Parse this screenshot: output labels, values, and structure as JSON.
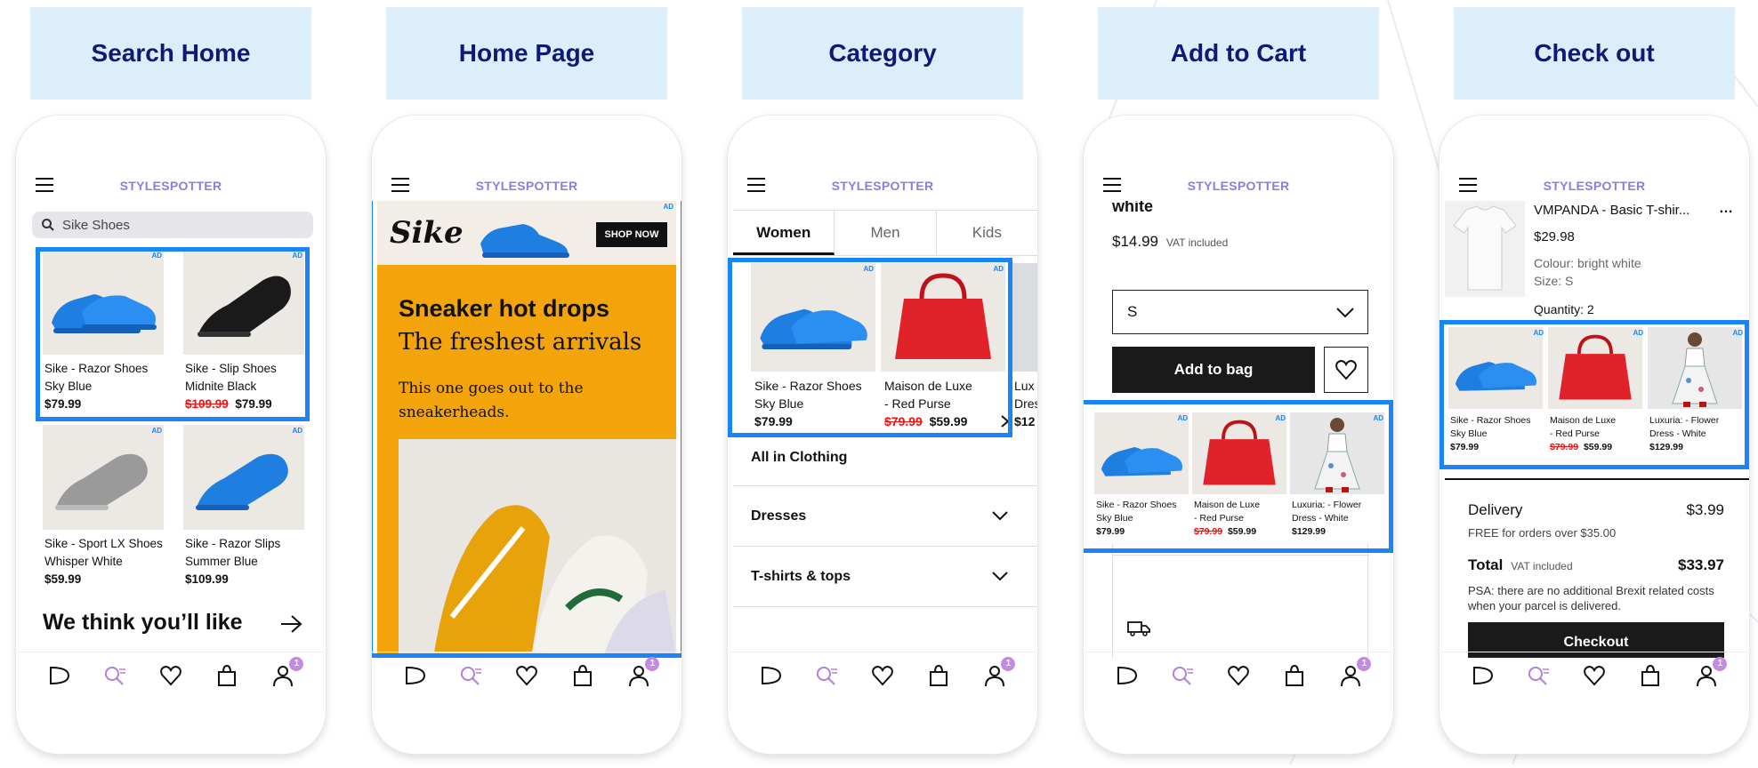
{
  "colors": {
    "accent": "#1a86f5",
    "brand": "#8a7de0",
    "label_bg": "#ddeefb",
    "strike": "#e11111"
  },
  "app": {
    "brand": "STYLESPOTTER",
    "nav_badge": "1",
    "ad_tag": "AD"
  },
  "steps": [
    {
      "label": "Search Home"
    },
    {
      "label": "Home Page"
    },
    {
      "label": "Category"
    },
    {
      "label": "Add to Cart"
    },
    {
      "label": "Check out"
    }
  ],
  "search": {
    "value": "Sike Shoes",
    "products": [
      {
        "name1": "Sike - Razor Shoes",
        "name2": "Sky Blue",
        "price": "$79.99",
        "old": ""
      },
      {
        "name1": "Sike - Slip Shoes",
        "name2": "Midnite Black",
        "price": "$79.99",
        "old": "$109.99"
      },
      {
        "name1": "Sike - Sport LX Shoes",
        "name2": "Whisper White",
        "price": "$59.99",
        "old": ""
      },
      {
        "name1": "Sike - Razor Slips",
        "name2": "Summer Blue",
        "price": "$109.99",
        "old": ""
      }
    ],
    "recommend_title": "We think you’ll like"
  },
  "home": {
    "banner_brand": "Sike",
    "shop_now": "SHOP NOW",
    "headline1": "Sneaker hot drops",
    "headline2": "The freshest arrivals",
    "body": "This one goes out to the sneakerheads."
  },
  "category": {
    "tabs": [
      "Women",
      "Men",
      "Kids"
    ],
    "products": [
      {
        "name1": "Sike - Razor Shoes",
        "name2": "Sky Blue",
        "price": "$79.99",
        "old": ""
      },
      {
        "name1": "Maison de Luxe",
        "name2": "- Red Purse",
        "price": "$59.99",
        "old": "$79.99"
      },
      {
        "name1": "Lux",
        "name2": "Dres",
        "price": "$12",
        "old": ""
      }
    ],
    "sections": [
      "All in Clothing",
      "Dresses",
      "T-shirts & tops"
    ]
  },
  "cart": {
    "color": "white",
    "price": "$14.99",
    "vat": "VAT included",
    "size": "S",
    "add_to_bag": "Add to bag",
    "products": [
      {
        "name1": "Sike - Razor Shoes",
        "name2": "Sky Blue",
        "price": "$79.99",
        "old": ""
      },
      {
        "name1": "Maison de Luxe",
        "name2": "- Red Purse",
        "price": "$59.99",
        "old": "$79.99"
      },
      {
        "name1": "Luxuria: - Flower",
        "name2": "Dress - White",
        "price": "$129.99",
        "old": ""
      }
    ]
  },
  "checkout": {
    "item_name": "VMPANDA - Basic T-shir...",
    "item_price": "$29.98",
    "colour": "Colour: bright white",
    "size": "Size: S",
    "quantity": "Quantity: 2",
    "products": [
      {
        "name1": "Sike - Razor Shoes",
        "name2": "Sky Blue",
        "price": "$79.99",
        "old": ""
      },
      {
        "name1": "Maison de Luxe",
        "name2": "- Red Purse",
        "price": "$59.99",
        "old": "$79.99"
      },
      {
        "name1": "Luxuria: - Flower",
        "name2": "Dress - White",
        "price": "$129.99",
        "old": ""
      }
    ],
    "delivery_label": "Delivery",
    "delivery_price": "$3.99",
    "free_note": "FREE for orders over $35.00",
    "total_label": "Total",
    "total_vat": "VAT included",
    "total_price": "$33.97",
    "psa": "PSA: there are no additional Brexit related costs when your parcel is delivered.",
    "checkout_btn": "Checkout"
  }
}
